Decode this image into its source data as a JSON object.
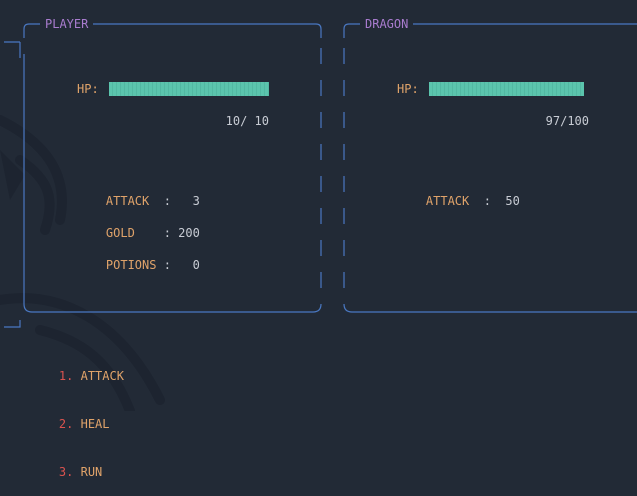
{
  "player": {
    "title": "PLAYER",
    "hp_label": "HP:",
    "hp_text": "10/ 10",
    "hp_fraction": 1.0,
    "stats": [
      {
        "label": "ATTACK",
        "sep": "  :   ",
        "value": "3"
      },
      {
        "label": "GOLD",
        "sep": "    : ",
        "value": "200"
      },
      {
        "label": "POTIONS",
        "sep": " :   ",
        "value": "0"
      }
    ]
  },
  "enemy": {
    "title": "DRAGON",
    "hp_label": "HP:",
    "hp_text": "97/100",
    "hp_fraction": 0.97,
    "stats": [
      {
        "label": "ATTACK",
        "sep": "  :  ",
        "value": "50"
      }
    ]
  },
  "menu": [
    {
      "num": "1.",
      "label": "ATTACK"
    },
    {
      "num": "2.",
      "label": "HEAL"
    },
    {
      "num": "3.",
      "label": "RUN"
    }
  ],
  "colors": {
    "background": "#222a36",
    "border": "#4a78c2",
    "title": "#a97ccf",
    "label": "#e0a36a",
    "hp_bar": "#5bc4ad",
    "menu_number": "#d9534f"
  }
}
